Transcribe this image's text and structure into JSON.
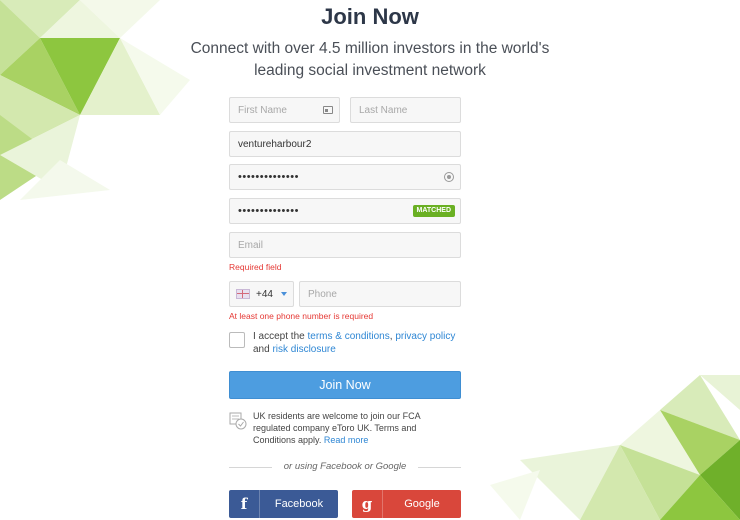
{
  "header": {
    "title": "Join Now",
    "subtitle": "Connect with over 4.5 million investors in the world's leading social investment network"
  },
  "form": {
    "first_name_placeholder": "First Name",
    "last_name_placeholder": "Last Name",
    "username_value": "ventureharbour2",
    "password_dots": "••••••••••••••",
    "confirm_dots": "••••••••••••••",
    "matched_badge": "MATCHED",
    "email_placeholder": "Email",
    "email_error": "Required field",
    "country_code": "+44",
    "phone_placeholder": "Phone",
    "phone_error": "At least one phone number is required",
    "terms": {
      "prefix": "I accept the ",
      "terms_link": "terms & conditions",
      "sep": ", ",
      "privacy_link": "privacy policy",
      "and": "and ",
      "risk_link": "risk disclosure"
    },
    "join_button": "Join Now",
    "uk_notice": "UK residents are welcome to join our FCA regulated company eToro UK. Terms and Conditions apply.",
    "read_more": "Read more",
    "or_text": "or using Facebook or Google",
    "facebook_label": "Facebook",
    "google_label": "Google",
    "facebook_glyph": "f",
    "google_glyph": "g"
  },
  "colors": {
    "join_blue": "#4d9de0",
    "facebook_blue": "#3b5a96",
    "google_red": "#d9473b",
    "matched_green": "#6ab023",
    "error_red": "#e53935",
    "link_blue": "#2f87d4"
  }
}
